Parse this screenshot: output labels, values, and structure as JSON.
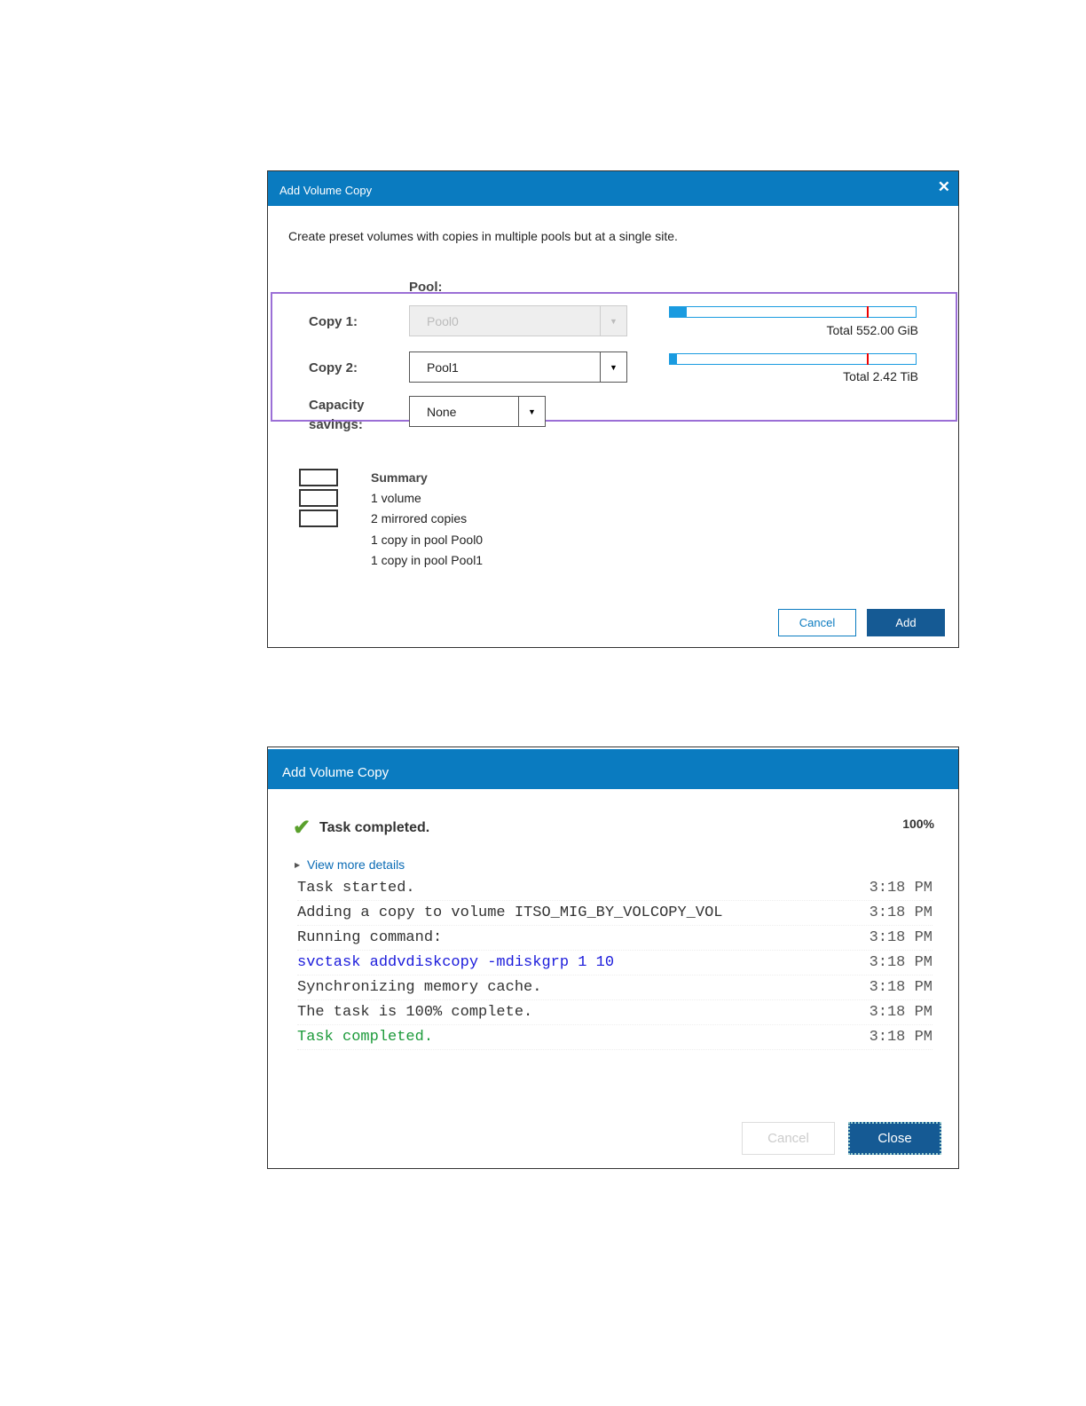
{
  "dialog1": {
    "title": "Add Volume Copy",
    "close_icon": "close-icon",
    "description": "Create preset volumes with copies in multiple pools but at a single site.",
    "pool_label": "Pool:",
    "copy1": {
      "label": "Copy 1:",
      "value": "Pool0",
      "disabled": true,
      "used_fraction": 0.07,
      "threshold_fraction": 0.8,
      "total": "Total 552.00 GiB"
    },
    "copy2": {
      "label": "Copy 2:",
      "value": "Pool1",
      "used_fraction": 0.03,
      "threshold_fraction": 0.8,
      "total": "Total 2.42 TiB"
    },
    "capacity_savings": {
      "label_line1": "Capacity",
      "label_line2": "savings:",
      "value": "None"
    },
    "summary": {
      "title": "Summary",
      "lines": [
        "1 volume",
        "2 mirrored copies",
        "1 copy in pool Pool0",
        "1 copy in pool Pool1"
      ]
    },
    "cancel_label": "Cancel",
    "add_label": "Add",
    "highlight_color": "#9b6fd6"
  },
  "dialog2": {
    "title": "Add Volume Copy",
    "status": "Task completed.",
    "percent": "100%",
    "details_link": "View more details",
    "log": [
      {
        "text": "Task started.",
        "time": "3:18 PM",
        "color": "#333333"
      },
      {
        "text": "Adding a copy to volume ITSO_MIG_BY_VOLCOPY_VOL",
        "time": "3:18 PM",
        "color": "#333333"
      },
      {
        "text": "Running command:",
        "time": "3:18 PM",
        "color": "#333333"
      },
      {
        "text": "svctask addvdiskcopy -mdiskgrp 1 10",
        "time": "3:18 PM",
        "color": "#1a1adb"
      },
      {
        "text": "Synchronizing memory cache.",
        "time": "3:18 PM",
        "color": "#333333"
      },
      {
        "text": "The task is 100% complete.",
        "time": "3:18 PM",
        "color": "#333333"
      },
      {
        "text": "Task completed.",
        "time": "3:18 PM",
        "color": "#1c9a3a"
      }
    ],
    "cancel_label": "Cancel",
    "close_label": "Close"
  }
}
